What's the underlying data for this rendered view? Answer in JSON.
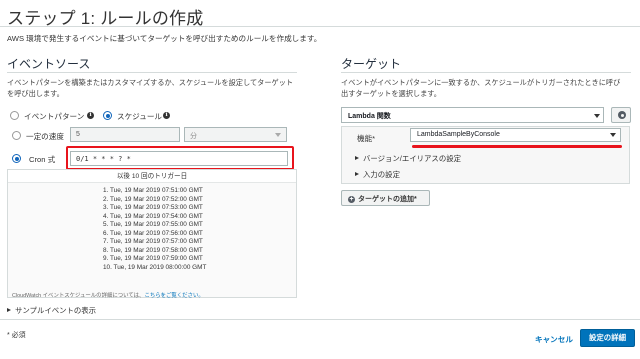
{
  "page": {
    "title": "ステップ 1: ルールの作成",
    "description": "AWS 環境で発生するイベントに基づいてターゲットを呼び出すためのルールを作成します。"
  },
  "event_source": {
    "title": "イベントソース",
    "description_line1": "イベントパターンを構築またはカスタマイズするか、スケジュールを設定してターゲット",
    "description_line2": "を呼び出します。",
    "option_event_pattern": "イベントパターン",
    "option_schedule": "スケジュール",
    "selected_option": "スケジュール",
    "fixed_rate_label": "一定の速度",
    "fixed_rate_value": "5",
    "fixed_rate_unit": "分",
    "cron_label": "Cron 式",
    "cron_value": "0/1 * * * ? *",
    "next_triggers_header": "以後 10 回のトリガー日",
    "next_triggers": [
      "1. Tue, 19 Mar 2019 07:51:00 GMT",
      "2. Tue, 19 Mar 2019 07:52:00 GMT",
      "3. Tue, 19 Mar 2019 07:53:00 GMT",
      "4. Tue, 19 Mar 2019 07:54:00 GMT",
      "5. Tue, 19 Mar 2019 07:55:00 GMT",
      "6. Tue, 19 Mar 2019 07:56:00 GMT",
      "7. Tue, 19 Mar 2019 07:57:00 GMT",
      "8. Tue, 19 Mar 2019 07:58:00 GMT",
      "9. Tue, 19 Mar 2019 07:59:00 GMT",
      "10. Tue, 19 Mar 2019 08:00:00 GMT"
    ],
    "note_prefix": "CloudWatch イベントスケジュールの詳細については、",
    "note_link": "こちらをご覧ください。",
    "show_sample": "サンプルイベントの表示"
  },
  "targets": {
    "title": "ターゲット",
    "description_line1": "イベントがイベントパターンに一致するか、スケジュールがトリガーされたときに呼び",
    "description_line2": "出すターゲットを選択します。",
    "target_type": "Lambda 関数",
    "function_label": "機能*",
    "function_value": "LambdaSampleByConsole",
    "version_alias": "バージョン/エイリアスの設定",
    "input_settings": "入力の設定",
    "add_target": "ターゲットの追加*"
  },
  "footer": {
    "required_note": "* 必須",
    "cancel": "キャンセル",
    "configure_details": "設定の詳細"
  },
  "colors": {
    "accent": "#0073bb",
    "highlight": "#e8141c"
  }
}
